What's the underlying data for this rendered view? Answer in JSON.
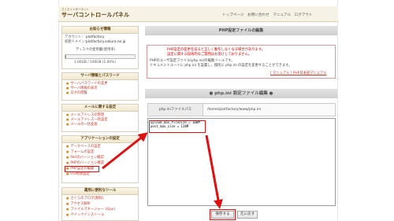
{
  "header": {
    "brand_small": "さくらインターネット",
    "brand": "サーバコントロールパネル",
    "nav": "トップページ　お問い合わせ　マニュアル　ログアウト"
  },
  "sidebar": {
    "info": {
      "title": "お知らせ情報",
      "account_label": "アカウント：",
      "account": "plotfactory",
      "domain_label": "初期ドメイン：",
      "domain": "plotfactory.sakura.ne.jp",
      "disk_label": "ディスクの使用量(使用率)",
      "disk_value": "1.00GB / 100GB (1.00%)"
    },
    "server_info": {
      "title": "サーバ情報とパスワード",
      "items": [
        "サーバパスワードの変更",
        "サーバ情報の表示",
        "ログの閲覧"
      ]
    },
    "mail": {
      "title": "メールに関する設定",
      "items": [
        "メールアドレスの管理",
        "メールアドレス一括設定",
        "メールの一括変換"
      ]
    },
    "app": {
      "title": "アプリケーションの設定",
      "items": [
        "データベースの設定",
        "フォームの設定",
        "Perlのバージョン確認",
        "PHPのバージョン確認",
        "PHP設定の編集",
        "CGI初期設定"
      ]
    },
    "tools": {
      "title": "運用に便利なツール",
      "items": [
        "さくらのブログ(無料)",
        "アクセス解析",
        "ファイルマネージャー (Ajax)",
        "クイックインストール"
      ]
    }
  },
  "main": {
    "panel_title": "PHP設定ファイルの編集",
    "notice_lines": [
      "PHP設定の変更を誤ると正しく動作しなくなる場合があります。",
      "設定に関する技術的なご質問はお受けしておりません。"
    ],
    "desc_lines": [
      "PHPのユーザ設定ファイル(php.ini)の編集ツールです。",
      "ドキュメントルートに php.ini を設置し、個別に php.ini の設定を変更することができます。"
    ],
    "manual_link": "[ マニュアル ] PHP日本語マニュアル",
    "edit_title": "● php.ini 設定ファイル編集 ●",
    "path_label": "php.iniファイルパス",
    "path_value": "/home/plotfactory/www/php.ini",
    "editor_content": "upload_max_filesize = 100M\npost_max_size = 128M",
    "save_label": "保存する",
    "reset_label": "元に戻す"
  },
  "colors": {
    "accent": "#e01010",
    "brand": "#5b3b07",
    "link": "#c0392b"
  }
}
